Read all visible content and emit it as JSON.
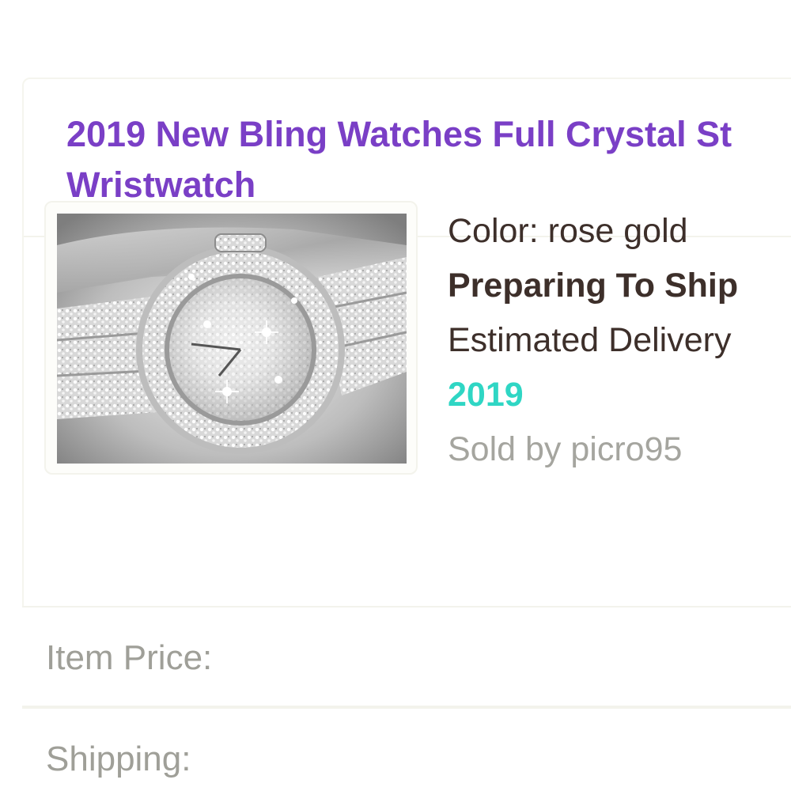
{
  "product": {
    "title_line1": "2019 New Bling Watches Full Crystal St",
    "title_line2": "Wristwatch",
    "image_alt": "Crystal-studded wristwatch photo",
    "color": "Color: rose gold",
    "status": "Preparing To Ship",
    "delivery": "Estimated Delivery",
    "year": "2019",
    "seller": "Sold by picro95"
  },
  "summary": {
    "item_price_label": "Item Price:",
    "shipping_label": "Shipping:"
  },
  "colors": {
    "title": "#7a3fc6",
    "year": "#2fd6c4",
    "primary_text": "#3d2f2a",
    "muted_text": "#a5a59f"
  }
}
